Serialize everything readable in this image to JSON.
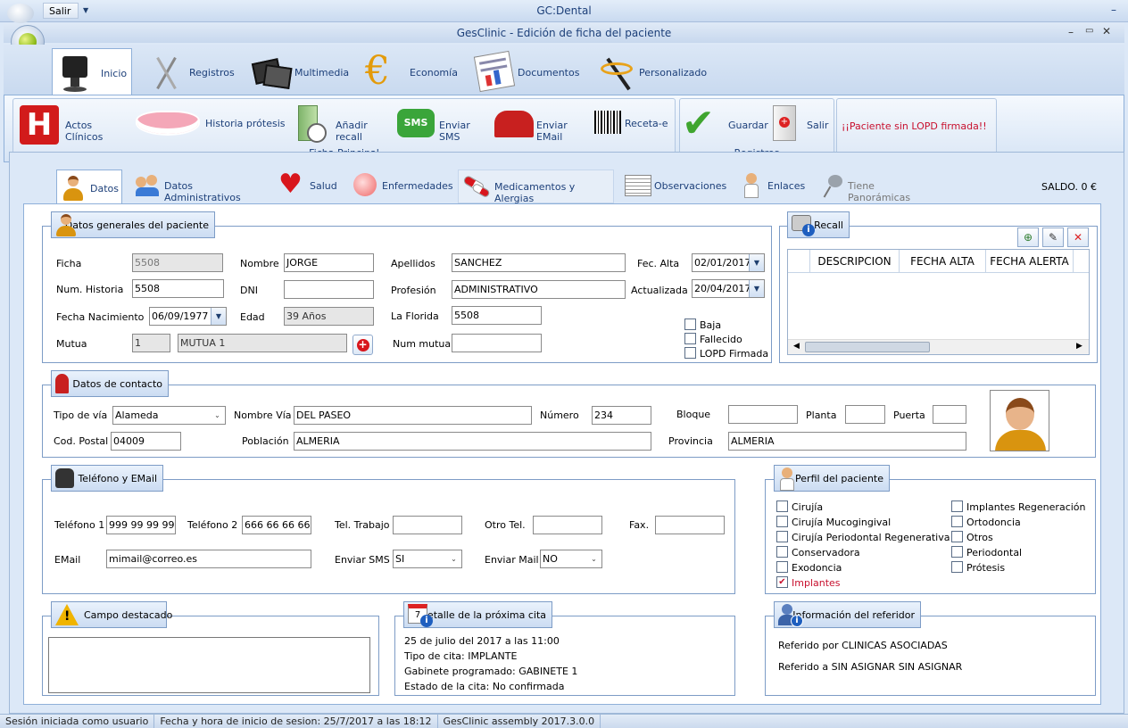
{
  "app": {
    "title": "GC:Dental",
    "quick_exit": "Salir"
  },
  "window": {
    "title": "GesClinic - Edición de ficha del paciente"
  },
  "ribbon_tabs": [
    "Inicio",
    "Registros",
    "Multimedia",
    "Economía",
    "Documentos",
    "Personalizado"
  ],
  "toolbar": {
    "actos": "Actos Clínicos",
    "protesis": "Historia prótesis",
    "recall": "Añadir recall",
    "sms": "Enviar SMS",
    "email": "Enviar EMail",
    "receta": "Receta-e",
    "group1": "Ficha Principal",
    "guardar": "Guardar",
    "salir": "Salir",
    "group2": "Registros",
    "alert": "¡¡Paciente sin LOPD firmada!!",
    "sms_icon": "SMS"
  },
  "patient_tabs": [
    "Datos",
    "Datos Administrativos",
    "Salud",
    "Enfermedades",
    "Medicamentos y Alergias",
    "Observaciones",
    "Enlaces",
    "Tiene Panorámicas"
  ],
  "saldo": "SALDO. 0 €",
  "general": {
    "title": "Datos generales del paciente",
    "ficha_l": "Ficha",
    "ficha": "5508",
    "nombre_l": "Nombre",
    "nombre": "JORGE",
    "apellidos_l": "Apellidos",
    "apellidos": "SANCHEZ",
    "fecalta_l": "Fec. Alta",
    "fecalta": "02/01/2017",
    "numhist_l": "Num. Historia",
    "numhist": "5508",
    "dni_l": "DNI",
    "dni": "",
    "profesion_l": "Profesión",
    "profesion": "ADMINISTRATIVO",
    "actualizada_l": "Actualizada",
    "actualizada": "20/04/2017",
    "fnac_l": "Fecha Nacimiento",
    "fnac": "06/09/1977",
    "edad_l": "Edad",
    "edad": "39 Años",
    "florida_l": "La Florida",
    "florida": "5508",
    "mutua_l": "Mutua",
    "mutua_num": "1",
    "mutua": "MUTUA 1",
    "nummutua_l": "Num mutua",
    "nummutua": "",
    "baja": "Baja",
    "fallecido": "Fallecido",
    "lopd": "LOPD Firmada"
  },
  "recall": {
    "title": "Recall",
    "columns": [
      "DESCRIPCION",
      "FECHA ALTA",
      "FECHA ALERTA"
    ]
  },
  "contacto": {
    "title": "Datos de contacto",
    "tipovia_l": "Tipo de vía",
    "tipovia": "Alameda",
    "nombrevia_l": "Nombre Vía",
    "nombrevia": "DEL PASEO",
    "numero_l": "Número",
    "numero": "234",
    "bloque_l": "Bloque",
    "planta_l": "Planta",
    "puerta_l": "Puerta",
    "cp_l": "Cod. Postal",
    "cp": "04009",
    "poblacion_l": "Población",
    "poblacion": "ALMERIA",
    "provincia_l": "Provincia",
    "provincia": "ALMERIA"
  },
  "telefono": {
    "title": "Teléfono y  EMail",
    "t1_l": "Teléfono 1",
    "t1": "999 99 99 99",
    "t2_l": "Teléfono 2",
    "t2": "666 66 66 66",
    "trabajo_l": "Tel. Trabajo",
    "otro_l": "Otro Tel.",
    "fax_l": "Fax.",
    "email_l": "EMail",
    "email": "mimail@correo.es",
    "sms_l": "Enviar SMS",
    "sms": "SI",
    "mail_l": "Enviar Mail",
    "mail": "NO"
  },
  "perfil": {
    "title": "Perfil del paciente",
    "left": [
      "Cirujía",
      "Cirujía Mucogingival",
      "Cirujía Periodontal Regenerativa",
      "Conservadora",
      "Exodoncia",
      "Implantes"
    ],
    "right": [
      "Implantes Regeneración",
      "Ortodoncia",
      "Otros",
      "Periodontal",
      "Prótesis"
    ],
    "checked": "Implantes"
  },
  "destacado": {
    "title": "Campo destacado"
  },
  "cita": {
    "title": "Detalle de la próxima cita",
    "lines": [
      "25 de julio del 2017 a las 11:00",
      "Tipo de cita: IMPLANTE",
      "Gabinete programado: GABINETE 1",
      "Estado de la cita: No confirmada"
    ]
  },
  "referidor": {
    "title": "Información del referidor",
    "lines": [
      "Referido por CLINICAS ASOCIADAS",
      "Referido a SIN ASIGNAR SIN ASIGNAR"
    ]
  },
  "status": [
    "Sesión iniciada como usuario",
    "Fecha y hora de inicio de sesion: 25/7/2017 a las 18:12",
    "GesClinic assembly 2017.3.0.0"
  ],
  "colors": {
    "accent": "#1c3f79",
    "alert": "#c8102e",
    "frame": "#7d9cc6"
  }
}
